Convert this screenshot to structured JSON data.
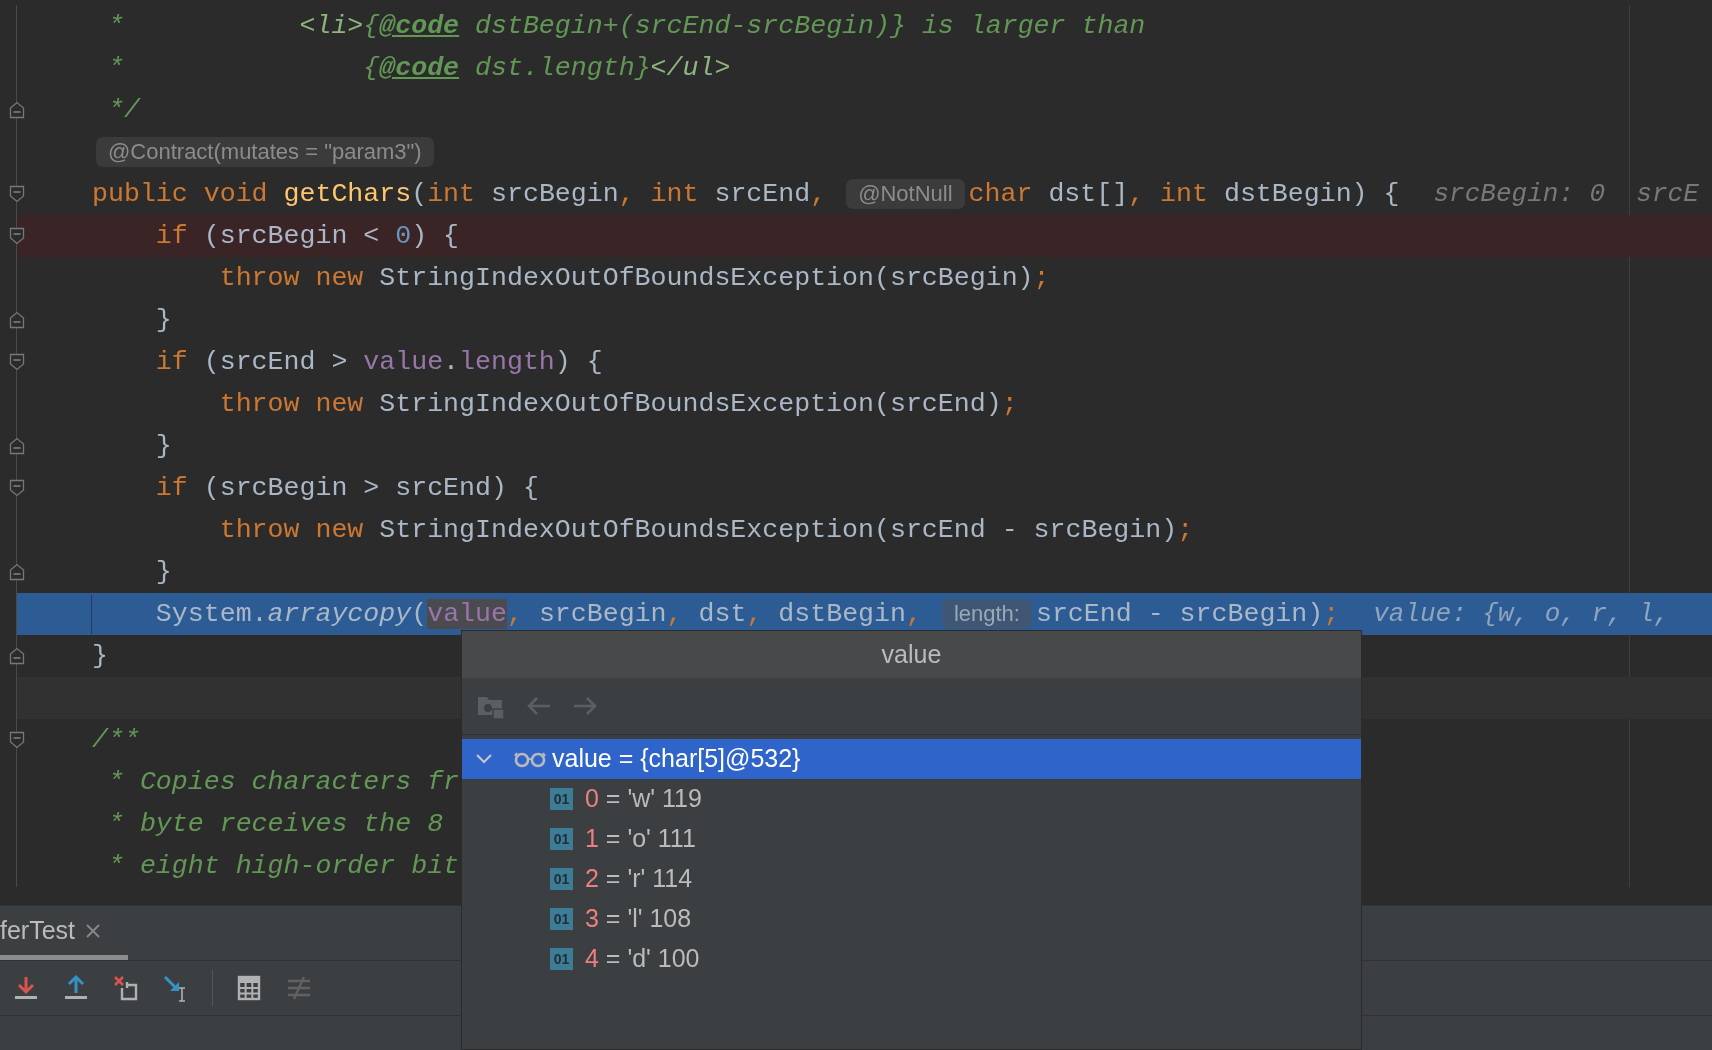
{
  "editor": {
    "lines": [
      {
        "kind": "normal",
        "segments": [
          {
            "kind": "code",
            "tokens": [
              {
                "text": " *           ",
                "kind": "comment"
              },
              {
                "text": "<li>",
                "kind": "html"
              },
              {
                "text": "{",
                "kind": "comment"
              },
              {
                "text": "@code",
                "kind": "doctag"
              },
              {
                "text": " dstBegin+(srcEnd-srcBegin)} is larger than",
                "kind": "comment"
              }
            ]
          }
        ]
      },
      {
        "kind": "normal",
        "segments": [
          {
            "kind": "code",
            "tokens": [
              {
                "text": " *               ",
                "kind": "comment"
              },
              {
                "text": "{",
                "kind": "comment"
              },
              {
                "text": "@code",
                "kind": "doctag"
              },
              {
                "text": " dst.length}",
                "kind": "comment"
              },
              {
                "text": "</ul>",
                "kind": "html"
              }
            ]
          }
        ]
      },
      {
        "kind": "normal",
        "fold_end": true,
        "segments": [
          {
            "kind": "code",
            "tokens": [
              {
                "text": " */",
                "kind": "comment"
              }
            ]
          }
        ]
      },
      {
        "kind": "normal",
        "segments": [
          {
            "kind": "hint",
            "text": "@Contract(mutates = \"param3\")"
          }
        ]
      },
      {
        "kind": "normal",
        "fold_start": true,
        "segments": [
          {
            "kind": "code",
            "tokens": [
              {
                "text": "public void ",
                "kind": "keyword"
              },
              {
                "text": "getChars",
                "kind": "method"
              },
              {
                "text": "(",
                "kind": "plain"
              },
              {
                "text": "int ",
                "kind": "keyword"
              },
              {
                "text": "srcBegin",
                "kind": "plain"
              },
              {
                "text": ", ",
                "kind": "punct"
              },
              {
                "text": "int ",
                "kind": "keyword"
              },
              {
                "text": "srcEnd",
                "kind": "plain"
              },
              {
                "text": ", ",
                "kind": "punct"
              }
            ]
          },
          {
            "kind": "hint",
            "text": "@NotNull"
          },
          {
            "kind": "code",
            "tokens": [
              {
                "text": "char ",
                "kind": "keyword"
              },
              {
                "text": "dst[]",
                "kind": "plain"
              },
              {
                "text": ", ",
                "kind": "punct"
              },
              {
                "text": "int ",
                "kind": "keyword"
              },
              {
                "text": "dstBegin) {",
                "kind": "plain"
              }
            ]
          },
          {
            "kind": "inline-value",
            "text": "srcBegin: 0  srcE"
          }
        ]
      },
      {
        "kind": "breakpoint",
        "fold_start": true,
        "segments": [
          {
            "kind": "code",
            "tokens": [
              {
                "text": "    if ",
                "kind": "keyword"
              },
              {
                "text": "(srcBegin < ",
                "kind": "plain"
              },
              {
                "text": "0",
                "kind": "number"
              },
              {
                "text": ") {",
                "kind": "plain"
              }
            ]
          }
        ]
      },
      {
        "kind": "normal",
        "segments": [
          {
            "kind": "code",
            "tokens": [
              {
                "text": "        throw new ",
                "kind": "keyword"
              },
              {
                "text": "StringIndexOutOfBoundsException(srcBegin)",
                "kind": "plain"
              },
              {
                "text": ";",
                "kind": "punct"
              }
            ]
          }
        ]
      },
      {
        "kind": "normal",
        "fold_end": true,
        "segments": [
          {
            "kind": "code",
            "tokens": [
              {
                "text": "    }",
                "kind": "plain"
              }
            ]
          }
        ]
      },
      {
        "kind": "normal",
        "fold_start": true,
        "segments": [
          {
            "kind": "code",
            "tokens": [
              {
                "text": "    if ",
                "kind": "keyword"
              },
              {
                "text": "(srcEnd > ",
                "kind": "plain"
              },
              {
                "text": "value",
                "kind": "field"
              },
              {
                "text": ".",
                "kind": "plain"
              },
              {
                "text": "length",
                "kind": "field"
              },
              {
                "text": ") {",
                "kind": "plain"
              }
            ]
          }
        ]
      },
      {
        "kind": "normal",
        "segments": [
          {
            "kind": "code",
            "tokens": [
              {
                "text": "        throw new ",
                "kind": "keyword"
              },
              {
                "text": "StringIndexOutOfBoundsException(srcEnd)",
                "kind": "plain"
              },
              {
                "text": ";",
                "kind": "punct"
              }
            ]
          }
        ]
      },
      {
        "kind": "normal",
        "fold_end": true,
        "segments": [
          {
            "kind": "code",
            "tokens": [
              {
                "text": "    }",
                "kind": "plain"
              }
            ]
          }
        ]
      },
      {
        "kind": "normal",
        "fold_start": true,
        "segments": [
          {
            "kind": "code",
            "tokens": [
              {
                "text": "    if ",
                "kind": "keyword"
              },
              {
                "text": "(srcBegin > srcEnd) {",
                "kind": "plain"
              }
            ]
          }
        ]
      },
      {
        "kind": "normal",
        "segments": [
          {
            "kind": "code",
            "tokens": [
              {
                "text": "        throw new ",
                "kind": "keyword"
              },
              {
                "text": "StringIndexOutOfBoundsException(srcEnd - srcBegin)",
                "kind": "plain"
              },
              {
                "text": ";",
                "kind": "punct"
              }
            ]
          }
        ]
      },
      {
        "kind": "normal",
        "fold_end": true,
        "segments": [
          {
            "kind": "code",
            "tokens": [
              {
                "text": "    }",
                "kind": "plain"
              }
            ]
          }
        ]
      },
      {
        "kind": "execution",
        "segments": [
          {
            "kind": "code",
            "tokens": [
              {
                "text": "    System.",
                "kind": "plain"
              },
              {
                "text": "arraycopy",
                "kind": "call"
              },
              {
                "text": "(",
                "kind": "plain"
              },
              {
                "text": "value",
                "kind": "field",
                "marked": true
              },
              {
                "text": ", ",
                "kind": "punct"
              },
              {
                "text": "srcBegin",
                "kind": "plain"
              },
              {
                "text": ", ",
                "kind": "punct"
              },
              {
                "text": "dst",
                "kind": "plain"
              },
              {
                "text": ", ",
                "kind": "punct"
              },
              {
                "text": "dstBegin",
                "kind": "plain"
              },
              {
                "text": ", ",
                "kind": "punct"
              }
            ]
          },
          {
            "kind": "hint",
            "text": "length:"
          },
          {
            "kind": "code",
            "tokens": [
              {
                "text": "srcEnd - srcBegin)",
                "kind": "plain"
              },
              {
                "text": ";",
                "kind": "punct"
              }
            ]
          },
          {
            "kind": "inline-value",
            "text": "value: {w, o, r, l,"
          }
        ]
      },
      {
        "kind": "normal",
        "fold_end": true,
        "segments": [
          {
            "kind": "code",
            "tokens": [
              {
                "text": "}",
                "kind": "plain"
              }
            ]
          }
        ]
      },
      {
        "kind": "band"
      },
      {
        "kind": "normal",
        "fold_start": true,
        "segments": [
          {
            "kind": "code",
            "tokens": [
              {
                "text": "/**",
                "kind": "comment"
              }
            ]
          }
        ]
      },
      {
        "kind": "normal",
        "segments": [
          {
            "kind": "code",
            "tokens": [
              {
                "text": " * Copies characters fr",
                "kind": "comment"
              }
            ]
          }
        ]
      },
      {
        "kind": "normal",
        "segments": [
          {
            "kind": "code",
            "tokens": [
              {
                "text": " * byte receives the 8",
                "kind": "comment"
              }
            ]
          }
        ]
      },
      {
        "kind": "normal",
        "segments": [
          {
            "kind": "code",
            "tokens": [
              {
                "text": " * eight high-order bit",
                "kind": "comment"
              }
            ]
          }
        ]
      }
    ]
  },
  "debug_panel": {
    "tab": {
      "label": "ferTest",
      "selected": true
    },
    "toolbar": [
      {
        "kind": "step-into",
        "disabled": false
      },
      {
        "kind": "step-out",
        "disabled": false
      },
      {
        "kind": "drop-frame",
        "disabled": false
      },
      {
        "kind": "run-to-cursor",
        "disabled": false
      },
      {
        "kind": "evaluate",
        "disabled": false
      },
      {
        "kind": "trace",
        "disabled": true
      }
    ]
  },
  "popup": {
    "title": "value",
    "toolbar": [
      {
        "kind": "folder",
        "disabled": true
      },
      {
        "kind": "back",
        "disabled": true
      },
      {
        "kind": "forward",
        "disabled": true
      }
    ],
    "tree": {
      "name": "value",
      "text": "= {char[5]@532}",
      "expanded": true,
      "selected": true,
      "children": [
        {
          "badge": "01",
          "name": "0",
          "text": "= 'w' 119",
          "selected": false
        },
        {
          "badge": "01",
          "name": "1",
          "text": "= 'o' 111",
          "selected": false
        },
        {
          "badge": "01",
          "name": "2",
          "text": "= 'r' 114",
          "selected": false
        },
        {
          "badge": "01",
          "name": "3",
          "text": "= 'l' 108",
          "selected": false
        },
        {
          "badge": "01",
          "name": "4",
          "text": "= 'd' 100",
          "selected": false
        }
      ]
    }
  }
}
